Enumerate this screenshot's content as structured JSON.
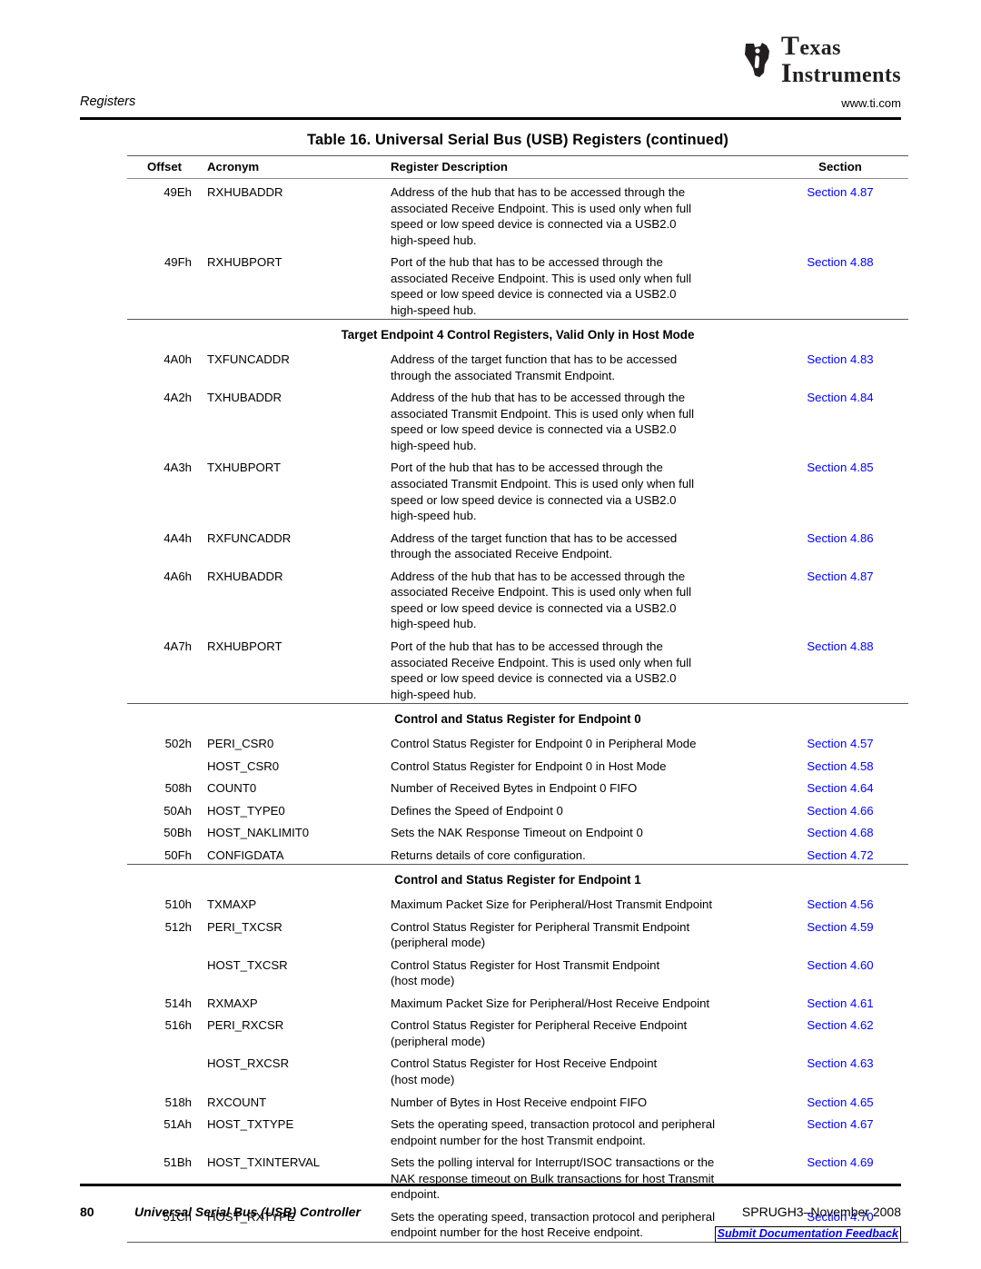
{
  "masthead": {
    "logo_icon": "texas-instruments-logo",
    "logo_line1": "Texas",
    "logo_line2": "Instruments"
  },
  "runhead": {
    "left": "Registers",
    "right": "www.ti.com"
  },
  "table": {
    "title": "Table 16. Universal Serial Bus (USB) Registers  (continued)",
    "columns": [
      "Offset",
      "Acronym",
      "Register Description",
      "Section"
    ],
    "rows": [
      {
        "kind": "data",
        "offset": "49Eh",
        "acronym": "RXHUBADDR",
        "description": [
          "Address of the hub that has to be accessed through the",
          "associated Receive Endpoint. This is used only when full",
          "speed or low speed device is connected via a USB2.0",
          "high-speed hub."
        ],
        "section": "Section 4.87"
      },
      {
        "kind": "data",
        "offset": "49Fh",
        "acronym": "RXHUBPORT",
        "description": [
          "Port of the hub that has to be accessed through the",
          "associated Receive Endpoint. This is used only when full",
          "speed or low speed device is connected via a USB2.0",
          "high-speed hub."
        ],
        "section": "Section 4.88"
      },
      {
        "kind": "group",
        "label": "Target Endpoint 4 Control Registers, Valid Only in Host Mode"
      },
      {
        "kind": "data",
        "offset": "4A0h",
        "acronym": "TXFUNCADDR",
        "description": [
          "Address of the target function that has to be accessed",
          "through the associated Transmit Endpoint."
        ],
        "section": "Section 4.83"
      },
      {
        "kind": "data",
        "offset": "4A2h",
        "acronym": "TXHUBADDR",
        "description": [
          "Address of the hub that has to be accessed through the",
          "associated Transmit Endpoint. This is used only when full",
          "speed or low speed device is connected via a USB2.0",
          "high-speed hub."
        ],
        "section": "Section 4.84"
      },
      {
        "kind": "data",
        "offset": "4A3h",
        "acronym": "TXHUBPORT",
        "description": [
          "Port of the hub that has to be accessed through the",
          "associated Transmit Endpoint. This is used only when full",
          "speed or low speed device is connected via a USB2.0",
          "high-speed hub."
        ],
        "section": "Section 4.85"
      },
      {
        "kind": "data",
        "offset": "4A4h",
        "acronym": "RXFUNCADDR",
        "description": [
          "Address of the target function that has to be accessed",
          "through the associated Receive Endpoint."
        ],
        "section": "Section 4.86"
      },
      {
        "kind": "data",
        "offset": "4A6h",
        "acronym": "RXHUBADDR",
        "description": [
          "Address of the hub that has to be accessed through the",
          "associated Receive Endpoint. This is used only when full",
          "speed or low speed device is connected via a USB2.0",
          "high-speed hub."
        ],
        "section": "Section 4.87"
      },
      {
        "kind": "data",
        "offset": "4A7h",
        "acronym": "RXHUBPORT",
        "description": [
          "Port of the hub that has to be accessed through the",
          "associated Receive Endpoint. This is used only when full",
          "speed or low speed device is connected via a USB2.0",
          "high-speed hub."
        ],
        "section": "Section 4.88"
      },
      {
        "kind": "group",
        "label": "Control and Status Register for Endpoint 0"
      },
      {
        "kind": "data",
        "offset": "502h",
        "acronym": "PERI_CSR0",
        "description": [
          "Control Status Register for Endpoint 0 in Peripheral Mode"
        ],
        "section": "Section 4.57"
      },
      {
        "kind": "data",
        "offset": "",
        "acronym": "HOST_CSR0",
        "description": [
          "Control Status Register for Endpoint 0 in Host Mode"
        ],
        "section": "Section 4.58"
      },
      {
        "kind": "data",
        "offset": "508h",
        "acronym": "COUNT0",
        "description": [
          "Number of Received Bytes in Endpoint 0 FIFO"
        ],
        "section": "Section 4.64"
      },
      {
        "kind": "data",
        "offset": "50Ah",
        "acronym": "HOST_TYPE0",
        "description": [
          "Defines the Speed of Endpoint 0"
        ],
        "section": "Section 4.66"
      },
      {
        "kind": "data",
        "offset": "50Bh",
        "acronym": "HOST_NAKLIMIT0",
        "description": [
          "Sets the NAK Response Timeout on Endpoint 0"
        ],
        "section": "Section 4.68"
      },
      {
        "kind": "data",
        "offset": "50Fh",
        "acronym": "CONFIGDATA",
        "description": [
          "Returns details of core configuration."
        ],
        "section": "Section 4.72"
      },
      {
        "kind": "group",
        "label": "Control and Status Register for Endpoint 1"
      },
      {
        "kind": "data",
        "offset": "510h",
        "acronym": "TXMAXP",
        "description": [
          "Maximum Packet Size for Peripheral/Host Transmit Endpoint"
        ],
        "section": "Section 4.56"
      },
      {
        "kind": "data",
        "offset": "512h",
        "acronym": "PERI_TXCSR",
        "description": [
          "Control Status Register for Peripheral Transmit Endpoint",
          "(peripheral mode)"
        ],
        "section": "Section 4.59"
      },
      {
        "kind": "data",
        "offset": "",
        "acronym": "HOST_TXCSR",
        "description": [
          "Control Status Register for Host Transmit Endpoint",
          "(host mode)"
        ],
        "section": "Section 4.60"
      },
      {
        "kind": "data",
        "offset": "514h",
        "acronym": "RXMAXP",
        "description": [
          "Maximum Packet Size for Peripheral/Host Receive Endpoint"
        ],
        "section": "Section 4.61"
      },
      {
        "kind": "data",
        "offset": "516h",
        "acronym": "PERI_RXCSR",
        "description": [
          "Control Status Register for Peripheral Receive Endpoint",
          "(peripheral mode)"
        ],
        "section": "Section 4.62"
      },
      {
        "kind": "data",
        "offset": "",
        "acronym": "HOST_RXCSR",
        "description": [
          "Control Status Register for Host Receive Endpoint",
          "(host mode)"
        ],
        "section": "Section 4.63"
      },
      {
        "kind": "data",
        "offset": "518h",
        "acronym": "RXCOUNT",
        "description": [
          "Number of Bytes in Host Receive endpoint FIFO"
        ],
        "section": "Section 4.65"
      },
      {
        "kind": "data",
        "offset": "51Ah",
        "acronym": "HOST_TXTYPE",
        "description": [
          "Sets the operating speed, transaction protocol and peripheral",
          "endpoint number for the host Transmit endpoint."
        ],
        "section": "Section 4.67"
      },
      {
        "kind": "data",
        "offset": "51Bh",
        "acronym": "HOST_TXINTERVAL",
        "description": [
          "Sets the polling interval for Interrupt/ISOC transactions or the",
          "NAK response timeout on Bulk transactions for host Transmit",
          "endpoint."
        ],
        "section": "Section 4.69"
      },
      {
        "kind": "data",
        "offset": "51Ch",
        "acronym": "HOST_RXTYPE",
        "description": [
          "Sets the operating speed, transaction protocol and peripheral",
          "endpoint number for the host Receive endpoint."
        ],
        "section": "Section 4.70"
      }
    ]
  },
  "footer": {
    "page_number": "80",
    "document_title": "Universal Serial Bus (USB) Controller",
    "document_id": "SPRUGH3–November 2008",
    "feedback_link": "Submit Documentation Feedback"
  },
  "colors": {
    "section_link": "#0000ff",
    "rule": "#55585a",
    "text": "#000000"
  }
}
